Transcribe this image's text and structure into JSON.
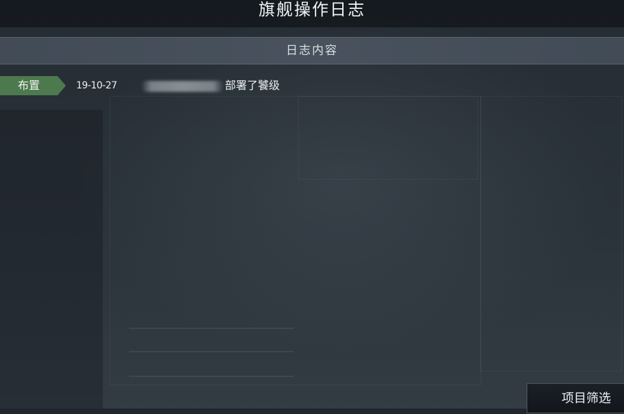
{
  "dialog": {
    "title": "旗舰操作日志",
    "header_label": "日志内容"
  },
  "log_entries": [
    {
      "category": "布置",
      "date": "19-10-27",
      "text": "部署了饕级"
    }
  ],
  "filter_button": {
    "label": "项目筛选"
  },
  "colors": {
    "category_tag": "#4c7a4e",
    "header_bar": "#4a5560",
    "background": "#20262e"
  }
}
